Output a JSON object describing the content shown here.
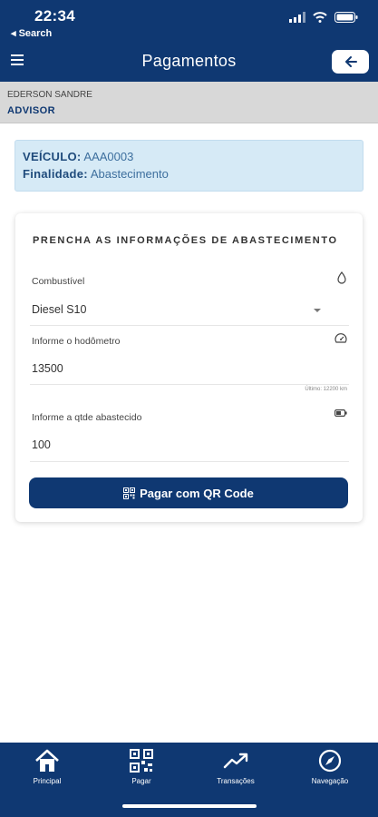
{
  "status_bar": {
    "time": "22:34",
    "back_label": "◂ Search"
  },
  "header": {
    "title": "Pagamentos"
  },
  "user": {
    "name": "EDERSON SANDRE",
    "role": "ADVISOR"
  },
  "vehicle": {
    "vehicle_label": "VEÍCULO:",
    "vehicle_value": "AAA0003",
    "purpose_label": "Finalidade:",
    "purpose_value": "Abastecimento"
  },
  "form": {
    "title": "PRENCHA AS INFORMAÇÕES DE ABASTECIMENTO",
    "fuel": {
      "label": "Combustível",
      "value": "Diesel S10",
      "icon": "droplet-icon"
    },
    "odometer": {
      "label": "Informe o hodômetro",
      "value": "13500",
      "hint": "Último: 12200 km",
      "icon": "speedometer-icon"
    },
    "quantity": {
      "label": "Informe a qtde abastecido",
      "value": "100",
      "icon": "fuel-level-icon"
    },
    "submit_label": "Pagar com QR Code"
  },
  "bottom_nav": [
    {
      "label": "Principal",
      "icon": "home-icon"
    },
    {
      "label": "Pagar",
      "icon": "qr-code-icon"
    },
    {
      "label": "Transações",
      "icon": "trending-up-icon"
    },
    {
      "label": "Navegação",
      "icon": "compass-icon"
    }
  ],
  "colors": {
    "primary": "#0f3872",
    "info_bg": "#d6eaf6",
    "user_bar_bg": "#d8d8d8"
  }
}
